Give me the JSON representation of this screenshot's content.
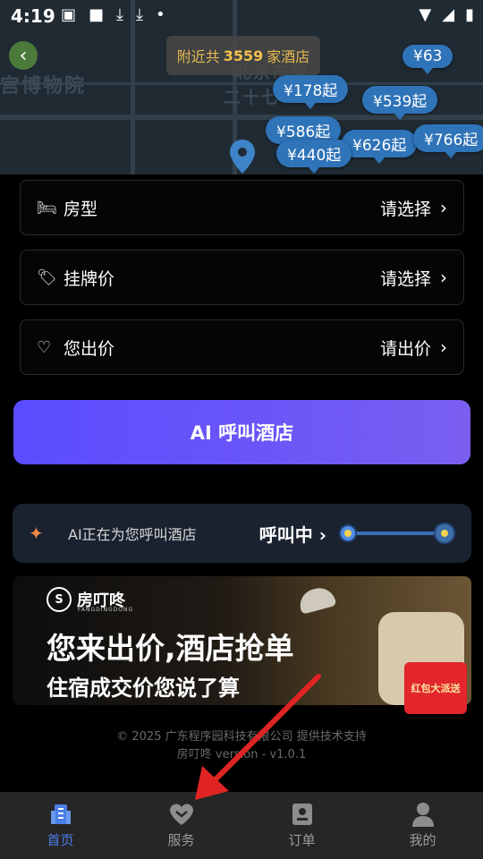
{
  "status_bar": {
    "time": "4:19"
  },
  "map": {
    "background_labels": [
      "宫博物院",
      "北京市第",
      "二十七"
    ],
    "back_icon": "chevron-left-icon",
    "nearby": {
      "prefix": "附近共",
      "count": "3559",
      "suffix": "家酒店"
    },
    "price_pins": [
      "¥63",
      "¥178起",
      "¥539起",
      "¥586起",
      "¥626起",
      "¥766起",
      "¥440起"
    ]
  },
  "form": {
    "room_type": {
      "label": "房型",
      "value": "请选择",
      "icon": "bed-icon"
    },
    "listed_price": {
      "label": "挂牌价",
      "value": "请选择",
      "icon": "price-tag-icon"
    },
    "your_bid": {
      "label": "您出价",
      "value": "请出价",
      "icon": "heart-price-icon"
    }
  },
  "ai_button": {
    "label": "AI 呼叫酒店"
  },
  "calling": {
    "text": "AI正在为您呼叫酒店",
    "state": "呼叫中"
  },
  "banner": {
    "brand": "房叮咚",
    "brand_sub": "FANGDINGDONG",
    "headline": "您来出价,酒店抢单",
    "subline": "住宿成交价您说了算",
    "red_packet": "红包大派送"
  },
  "footer": {
    "copyright": "© 2025 广东程序园科技有限公司 提供技术支持",
    "version": "房叮咚 version - v1.0.1"
  },
  "nav": [
    {
      "label": "首页",
      "icon": "home-building-icon",
      "active": true
    },
    {
      "label": "服务",
      "icon": "heart-service-icon",
      "active": false
    },
    {
      "label": "订单",
      "icon": "order-list-icon",
      "active": false
    },
    {
      "label": "我的",
      "icon": "user-profile-icon",
      "active": false
    }
  ],
  "colors": {
    "accent": "#4a7ee8",
    "button_gradient_start": "#5a4cff",
    "price_gold": "#f4c14c",
    "pin_blue": "#2f73b8",
    "annotation_red": "#e02424"
  }
}
